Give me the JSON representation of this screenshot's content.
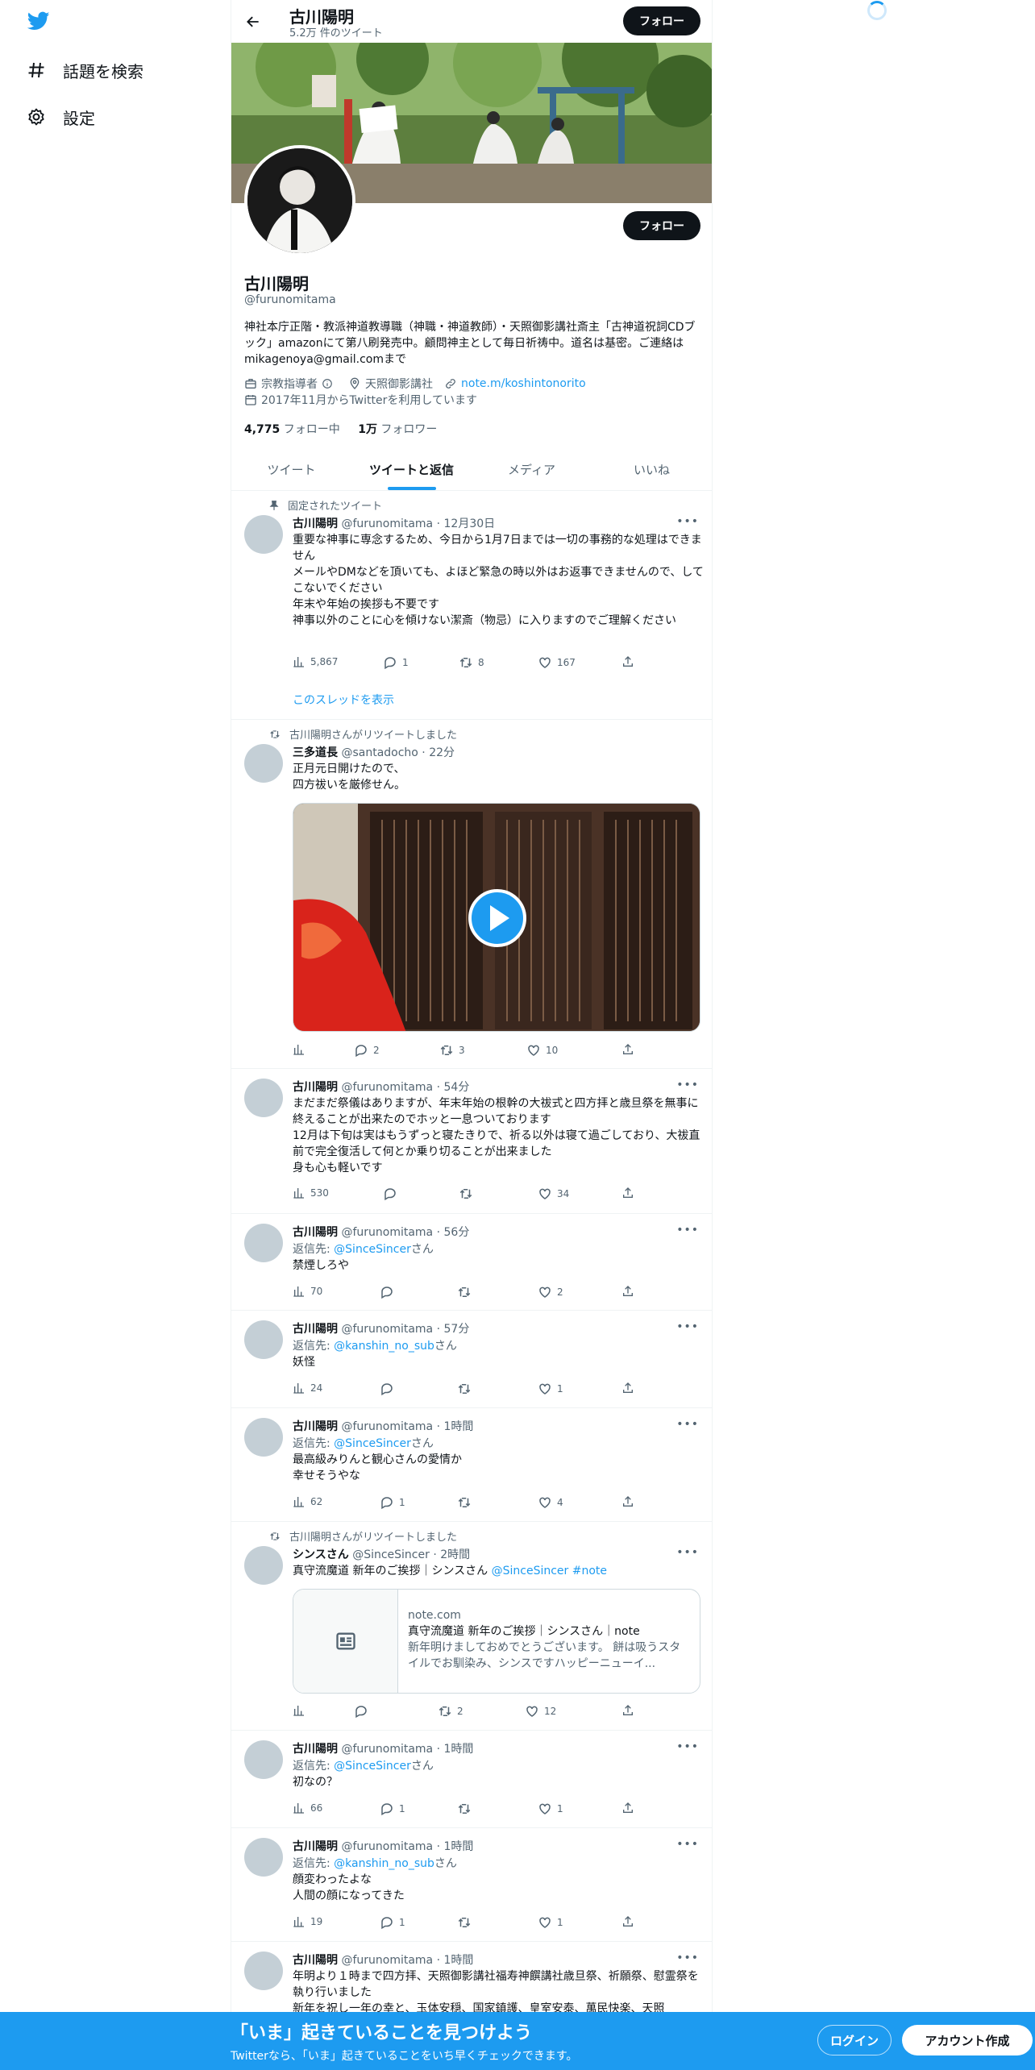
{
  "nav": {
    "items": [
      {
        "label": "話題を検索",
        "icon": "hashtag-icon"
      },
      {
        "label": "設定",
        "icon": "gear-icon"
      }
    ]
  },
  "header": {
    "name": "古川陽明",
    "tweet_count": "5.2万 件のツイート",
    "follow_label": "フォロー"
  },
  "profile": {
    "follow_label": "フォロー",
    "name": "古川陽明",
    "handle": "@furunomitama",
    "bio": "神社本庁正階・教派神道教導職（神職・神道教師）・天照御影講社斎主「古神道祝詞CDブック」amazonにて第八刷発売中。顧問神主として毎日祈祷中。道名は基密。ご連絡はmikagenoya@gmail.comまで",
    "category": "宗教指導者",
    "location": "天照御影講社",
    "url": "note.m/koshintonorito",
    "joined": "2017年11月からTwitterを利用しています",
    "following_count": "4,775",
    "following_label": " フォロー中",
    "followers_count": "1万",
    "followers_label": " フォロワー"
  },
  "tabs": [
    "ツイート",
    "ツイートと返信",
    "メディア",
    "いいね"
  ],
  "tweets": [
    {
      "context": "固定されたツイート",
      "name": "古川陽明",
      "handle": "@furunomitama",
      "time": "12月30日",
      "text": "重要な神事に専念するため、今日から1月7日までは一切の事務的な処理はできません\nメールやDMなどを頂いても、よほど緊急の時以外はお返事できませんので、してこないでください\n年末や年始の挨拶も不要です\n神事以外のことに心を傾けない潔斎（物忌）に入りますのでご理解ください",
      "views": "5,867",
      "replies": "1",
      "retweets": "8",
      "likes": "167",
      "show_thread": "このスレッドを表示"
    },
    {
      "context": "古川陽明さんがリツイートしました",
      "name": "三多道長",
      "handle": "@santadocho",
      "time": "22分",
      "text": "正月元日開けたので、\n四方祓いを厳修せん。",
      "views": "",
      "replies": "2",
      "retweets": "3",
      "likes": "10"
    },
    {
      "name": "古川陽明",
      "handle": "@furunomitama",
      "time": "54分",
      "text": "まだまだ祭儀はありますが、年末年始の根幹の大祓式と四方拝と歳旦祭を無事に終えることが出来たのでホッと一息ついております\n12月は下旬は実はもうずっと寝たきりで、祈る以外は寝て過ごしており、大祓直前で完全復活して何とか乗り切ることが出来ました\n身も心も軽いです",
      "views": "530",
      "replies": "",
      "retweets": "",
      "likes": "34"
    },
    {
      "name": "古川陽明",
      "handle": "@furunomitama",
      "time": "56分",
      "reply_prefix": "返信先: ",
      "reply_to": "@SinceSincer",
      "reply_suffix": "さん",
      "text": "禁煙しろや",
      "views": "70",
      "replies": "",
      "retweets": "",
      "likes": "2"
    },
    {
      "name": "古川陽明",
      "handle": "@furunomitama",
      "time": "57分",
      "reply_prefix": "返信先: ",
      "reply_to": "@kanshin_no_sub",
      "reply_suffix": "さん",
      "text": "妖怪",
      "views": "24",
      "replies": "",
      "retweets": "",
      "likes": "1"
    },
    {
      "name": "古川陽明",
      "handle": "@furunomitama",
      "time": "1時間",
      "reply_prefix": "返信先: ",
      "reply_to": "@SinceSincer",
      "reply_suffix": "さん",
      "text": "最高級みりんと観心さんの愛情か\n幸せそうやな",
      "views": "62",
      "replies": "1",
      "retweets": "",
      "likes": "4"
    },
    {
      "context": "古川陽明さんがリツイートしました",
      "name": "シンスさん",
      "handle": "@SinceSincer",
      "time": "2時間",
      "text_plain": "真守流魔道 新年のご挨拶｜シンスさん ",
      "text_mention": "@SinceSincer",
      "text_tag": " #note",
      "card_domain": "note.com",
      "card_title": "真守流魔道 新年のご挨拶｜シンスさん｜note",
      "card_desc": "新年明けましておめでとうございます。 餅は吸うスタイルでお馴染み、シンスですハッピーニューイ...",
      "views": "",
      "replies": "",
      "retweets": "2",
      "likes": "12"
    },
    {
      "name": "古川陽明",
      "handle": "@furunomitama",
      "time": "1時間",
      "reply_prefix": "返信先: ",
      "reply_to": "@SinceSincer",
      "reply_suffix": "さん",
      "text": "初なの？",
      "views": "66",
      "replies": "1",
      "retweets": "",
      "likes": "1"
    },
    {
      "name": "古川陽明",
      "handle": "@furunomitama",
      "time": "1時間",
      "reply_prefix": "返信先: ",
      "reply_to": "@kanshin_no_sub",
      "reply_suffix": "さん",
      "text": "顔変わったよな\n人間の顔になってきた",
      "views": "19",
      "replies": "1",
      "retweets": "",
      "likes": "1"
    },
    {
      "name": "古川陽明",
      "handle": "@furunomitama",
      "time": "1時間",
      "text": "年明より１時まで四方拝、天照御影講社福寿神饌講社歳旦祭、祈願祭、慰霊祭を執り行いました\n新年を祝し一年の幸と、玉体安穏、国家鎮護、皇室安泰、萬民快楽、天照"
    }
  ],
  "bottom_bar": {
    "title": "「いま」起きていることを見つけよう",
    "subtitle": "Twitterなら、「いま」起きていることをいち早くチェックできます。",
    "login": "ログイン",
    "signup": "アカウント作成"
  },
  "colors": {
    "accent": "#1d9bf0",
    "text": "#0f1419",
    "muted": "#536471"
  }
}
